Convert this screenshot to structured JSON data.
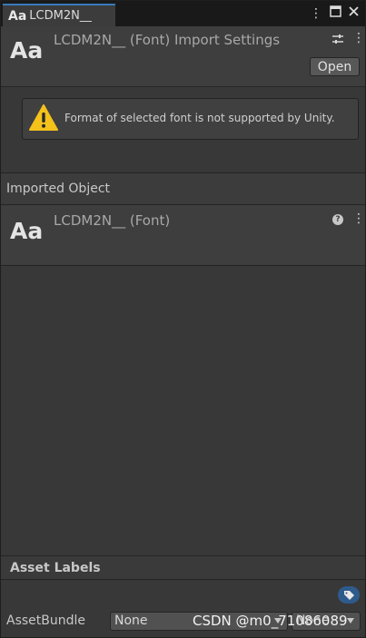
{
  "tab": {
    "icon": "Aa",
    "label": "LCDM2N__"
  },
  "header": {
    "icon": "Aa",
    "title": "LCDM2N__ (Font) Import Settings",
    "open_label": "Open"
  },
  "warning": {
    "icon": "warning-icon",
    "text": "Format of selected font is not supported by Unity."
  },
  "imported": {
    "section_label": "Imported Object",
    "icon": "Aa",
    "title": "LCDM2N__ (Font)"
  },
  "asset_labels": {
    "title": "Asset Labels",
    "asset_bundle_label": "AssetBundle",
    "bundle_value": "None",
    "variant_value": "None"
  },
  "watermark": "CSDN @m0_71086089",
  "colors": {
    "background": "#383838",
    "tab_accent": "#3a79bb",
    "warning": "#f4c21b",
    "tag_button": "#2f5a8c"
  }
}
